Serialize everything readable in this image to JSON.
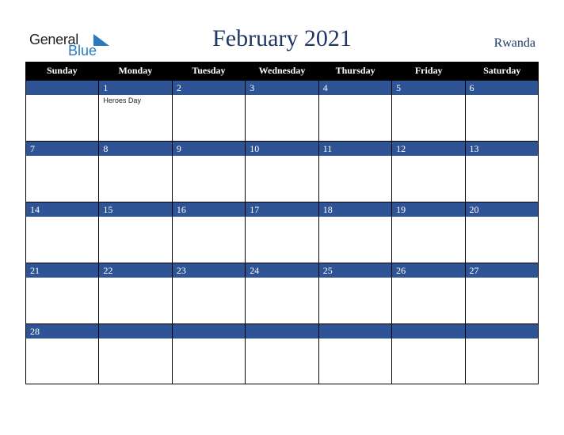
{
  "logo": {
    "line1": "General",
    "line2": "Blue"
  },
  "title": "February 2021",
  "country": "Rwanda",
  "weekdays": [
    "Sunday",
    "Monday",
    "Tuesday",
    "Wednesday",
    "Thursday",
    "Friday",
    "Saturday"
  ],
  "weeks": [
    [
      {
        "day": "",
        "event": ""
      },
      {
        "day": "1",
        "event": "Heroes Day"
      },
      {
        "day": "2",
        "event": ""
      },
      {
        "day": "3",
        "event": ""
      },
      {
        "day": "4",
        "event": ""
      },
      {
        "day": "5",
        "event": ""
      },
      {
        "day": "6",
        "event": ""
      }
    ],
    [
      {
        "day": "7",
        "event": ""
      },
      {
        "day": "8",
        "event": ""
      },
      {
        "day": "9",
        "event": ""
      },
      {
        "day": "10",
        "event": ""
      },
      {
        "day": "11",
        "event": ""
      },
      {
        "day": "12",
        "event": ""
      },
      {
        "day": "13",
        "event": ""
      }
    ],
    [
      {
        "day": "14",
        "event": ""
      },
      {
        "day": "15",
        "event": ""
      },
      {
        "day": "16",
        "event": ""
      },
      {
        "day": "17",
        "event": ""
      },
      {
        "day": "18",
        "event": ""
      },
      {
        "day": "19",
        "event": ""
      },
      {
        "day": "20",
        "event": ""
      }
    ],
    [
      {
        "day": "21",
        "event": ""
      },
      {
        "day": "22",
        "event": ""
      },
      {
        "day": "23",
        "event": ""
      },
      {
        "day": "24",
        "event": ""
      },
      {
        "day": "25",
        "event": ""
      },
      {
        "day": "26",
        "event": ""
      },
      {
        "day": "27",
        "event": ""
      }
    ],
    [
      {
        "day": "28",
        "event": ""
      },
      {
        "day": "",
        "event": ""
      },
      {
        "day": "",
        "event": ""
      },
      {
        "day": "",
        "event": ""
      },
      {
        "day": "",
        "event": ""
      },
      {
        "day": "",
        "event": ""
      },
      {
        "day": "",
        "event": ""
      }
    ]
  ]
}
